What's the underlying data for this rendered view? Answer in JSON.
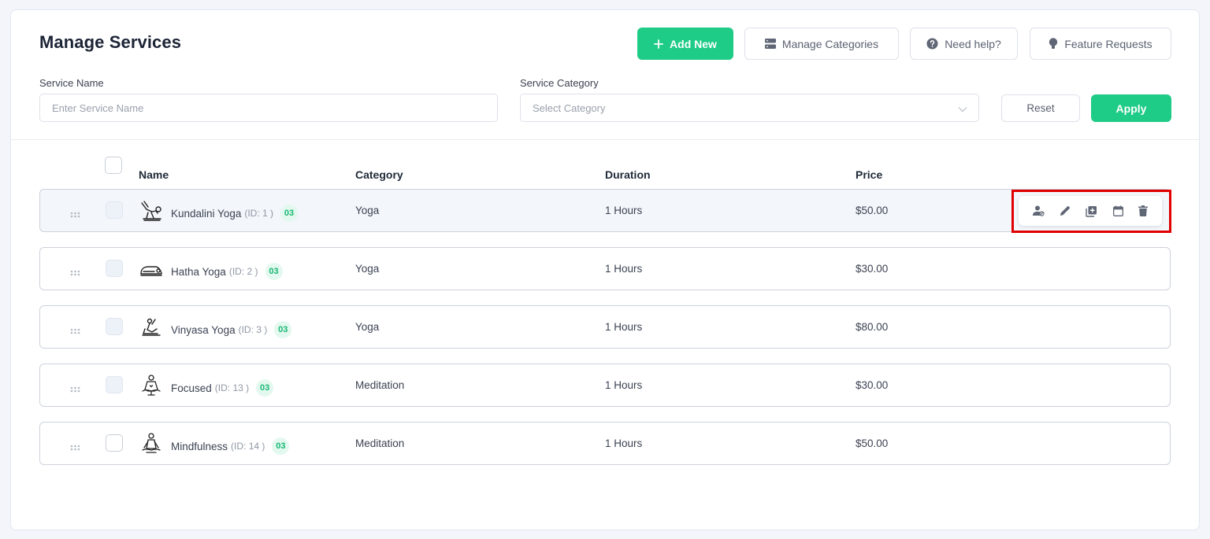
{
  "header": {
    "title": "Manage Services",
    "buttons": {
      "add_new": "Add New",
      "manage_categories": "Manage Categories",
      "need_help": "Need help?",
      "feature_requests": "Feature Requests"
    }
  },
  "filters": {
    "service_name": {
      "label": "Service Name",
      "placeholder": "Enter Service Name",
      "value": ""
    },
    "service_category": {
      "label": "Service Category",
      "placeholder": "Select Category"
    },
    "reset_label": "Reset",
    "apply_label": "Apply"
  },
  "table": {
    "columns": [
      "Name",
      "Category",
      "Duration",
      "Price"
    ],
    "rows": [
      {
        "name": "Kundalini Yoga",
        "id": "(ID: 1 )",
        "badge": "03",
        "category": "Yoga",
        "duration": "1 Hours",
        "price": "$50.00",
        "icon": "kundalini-yoga-icon",
        "checkbox": "filled"
      },
      {
        "name": "Hatha Yoga",
        "id": "(ID: 2 )",
        "badge": "03",
        "category": "Yoga",
        "duration": "1 Hours",
        "price": "$30.00",
        "icon": "hatha-yoga-icon",
        "checkbox": "filled"
      },
      {
        "name": "Vinyasa Yoga",
        "id": "(ID: 3 )",
        "badge": "03",
        "category": "Yoga",
        "duration": "1 Hours",
        "price": "$80.00",
        "icon": "vinyasa-yoga-icon",
        "checkbox": "filled"
      },
      {
        "name": "Focused",
        "id": "(ID: 13 )",
        "badge": "03",
        "category": "Meditation",
        "duration": "1 Hours",
        "price": "$30.00",
        "icon": "focused-meditation-icon",
        "checkbox": "filled"
      },
      {
        "name": "Mindfulness",
        "id": "(ID: 14 )",
        "badge": "03",
        "category": "Meditation",
        "duration": "1 Hours",
        "price": "$50.00",
        "icon": "mindfulness-meditation-icon",
        "checkbox": "empty"
      }
    ],
    "row_actions": [
      "assign-staff-icon",
      "edit-icon",
      "duplicate-icon",
      "calendar-icon",
      "delete-icon"
    ]
  },
  "colors": {
    "accent": "#1fcc87",
    "badge_bg": "#e3f8ee",
    "badge_text": "#18b874",
    "highlight_border": "#e00000"
  }
}
